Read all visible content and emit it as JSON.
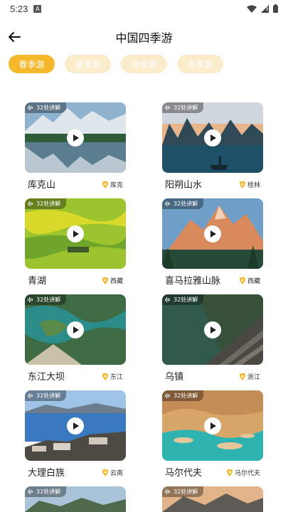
{
  "status_bar": {
    "time": "5:23",
    "notification_glyph": "A"
  },
  "header": {
    "title": "中国四季游"
  },
  "tabs": [
    {
      "label": "春季游",
      "active": true
    },
    {
      "label": "夏季游",
      "active": false
    },
    {
      "label": "秋季游",
      "active": false
    },
    {
      "label": "冬季游",
      "active": false
    }
  ],
  "colors": {
    "accent": "#f5b82a",
    "tab_inactive": "#fbeccb",
    "location_pin": "#f5b82a"
  },
  "cards": [
    {
      "name": "库克山",
      "location": "库克",
      "badge": "32处讲解"
    },
    {
      "name": "阳朔山水",
      "location": "桂林",
      "badge": "32处讲解"
    },
    {
      "name": "青湖",
      "location": "西藏",
      "badge": "32处讲解"
    },
    {
      "name": "喜马拉雅山脉",
      "location": "西藏",
      "badge": "32处讲解"
    },
    {
      "name": "东江大坝",
      "location": "东江",
      "badge": "32处讲解"
    },
    {
      "name": "乌镇",
      "location": "浙江",
      "badge": "32处讲解"
    },
    {
      "name": "大理白族",
      "location": "云南",
      "badge": "32处讲解"
    },
    {
      "name": "马尔代夫",
      "location": "马尔代夫",
      "badge": "32处讲解"
    },
    {
      "name": "",
      "location": "",
      "badge": "32处讲解"
    },
    {
      "name": "",
      "location": "",
      "badge": "32处讲解"
    }
  ]
}
